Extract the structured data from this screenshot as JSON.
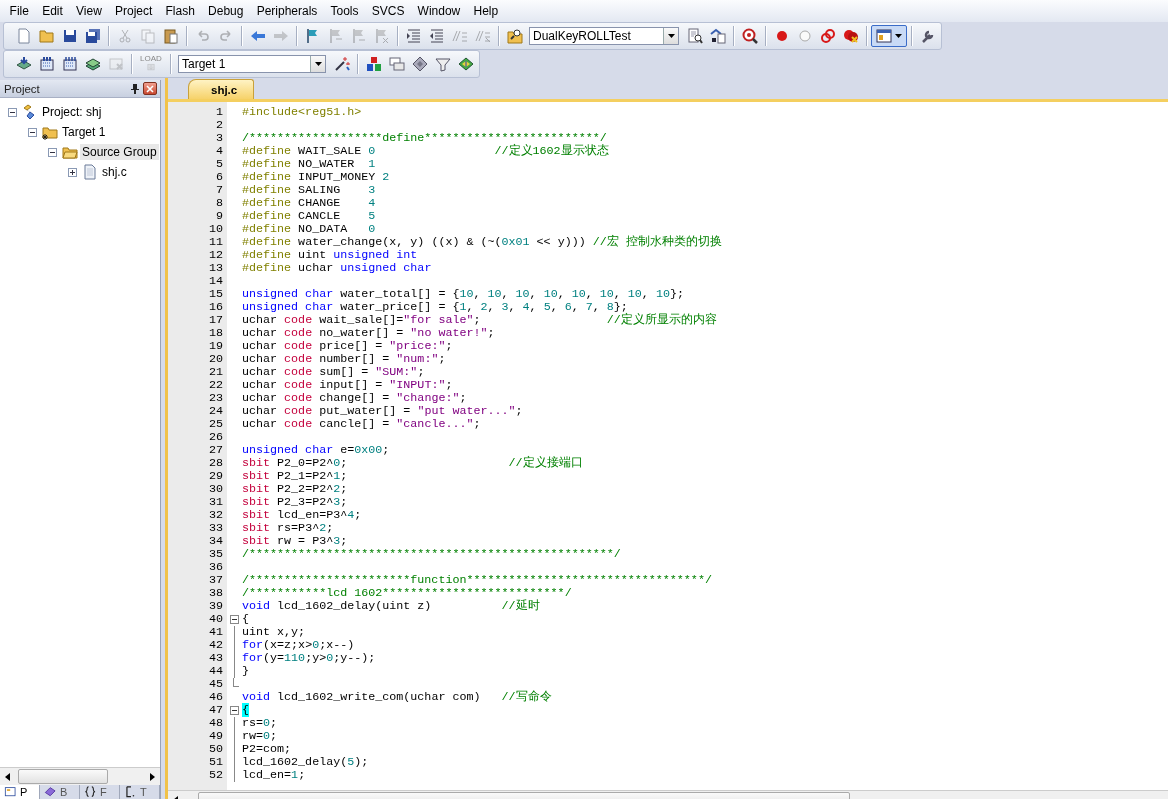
{
  "menu": [
    "File",
    "Edit",
    "View",
    "Project",
    "Flash",
    "Debug",
    "Peripherals",
    "Tools",
    "SVCS",
    "Window",
    "Help"
  ],
  "toolbar_1": [
    [
      {
        "kind": "new-file",
        "disabled": false,
        "on": false
      },
      {
        "kind": "open-file",
        "disabled": false,
        "on": false
      },
      {
        "kind": "save",
        "disabled": false,
        "on": false
      },
      {
        "kind": "save-all",
        "disabled": false,
        "on": false
      }
    ],
    [
      {
        "kind": "cut",
        "disabled": true,
        "on": false
      },
      {
        "kind": "copy",
        "disabled": true,
        "on": false
      },
      {
        "kind": "paste",
        "disabled": false,
        "on": false
      }
    ],
    [
      {
        "kind": "undo",
        "disabled": true,
        "on": false
      },
      {
        "kind": "redo",
        "disabled": true,
        "on": false
      }
    ],
    [
      {
        "kind": "nav-back",
        "disabled": false,
        "on": false
      },
      {
        "kind": "nav-forward",
        "disabled": true,
        "on": false
      }
    ],
    [
      {
        "kind": "bookmark",
        "disabled": false,
        "on": false
      },
      {
        "kind": "bookmark-prev",
        "disabled": true,
        "on": false
      },
      {
        "kind": "bookmark-next",
        "disabled": true,
        "on": false
      },
      {
        "kind": "bookmark-clear",
        "disabled": true,
        "on": false
      }
    ],
    [
      {
        "kind": "indent",
        "disabled": false,
        "on": false
      },
      {
        "kind": "unindent",
        "disabled": false,
        "on": false
      },
      {
        "kind": "comment",
        "disabled": true,
        "on": false
      },
      {
        "kind": "uncomment",
        "disabled": true,
        "on": false
      }
    ],
    [
      {
        "kind": "find-in-files",
        "disabled": false,
        "on": false
      },
      {
        "kind": "combo",
        "value": "DualKeyROLLTest"
      },
      {
        "kind": "find",
        "disabled": false,
        "on": false
      },
      {
        "kind": "incremental-find",
        "disabled": false,
        "on": false
      }
    ],
    [
      {
        "kind": "debug",
        "disabled": false,
        "on": false
      }
    ],
    [
      {
        "kind": "breakpoint",
        "disabled": false,
        "on": false
      },
      {
        "kind": "breakpoint-off",
        "disabled": false,
        "on": false
      },
      {
        "kind": "breakpoint-disable-all",
        "disabled": false,
        "on": false
      },
      {
        "kind": "breakpoint-kill-all",
        "disabled": false,
        "on": false
      }
    ],
    [
      {
        "kind": "window-layout",
        "disabled": false,
        "on": true
      }
    ],
    [
      {
        "kind": "configure",
        "disabled": false,
        "on": false
      }
    ]
  ],
  "toolbar_2": [
    [
      {
        "kind": "translate",
        "disabled": false,
        "on": false
      },
      {
        "kind": "build",
        "disabled": false,
        "on": false
      },
      {
        "kind": "rebuild",
        "disabled": false,
        "on": false
      },
      {
        "kind": "batch-build",
        "disabled": false,
        "on": false
      },
      {
        "kind": "stop-build",
        "disabled": true,
        "on": false
      }
    ],
    [
      {
        "kind": "download",
        "label": "LOAD",
        "disabled": true,
        "on": false
      }
    ],
    [
      {
        "kind": "combo",
        "value": "Target 1"
      },
      {
        "kind": "target-options",
        "disabled": false,
        "on": false
      }
    ],
    [
      {
        "kind": "manage-components",
        "disabled": false,
        "on": false
      },
      {
        "kind": "select-packs",
        "disabled": false,
        "on": false
      },
      {
        "kind": "pack-installer",
        "disabled": false,
        "on": false
      },
      {
        "kind": "run-time-environment",
        "disabled": false,
        "on": false
      },
      {
        "kind": "pack-manager",
        "disabled": false,
        "on": false
      }
    ]
  ],
  "project_panel": {
    "title": "Project",
    "tree": [
      {
        "label": "Project: shj",
        "kind": "project",
        "expanded": true,
        "selected": false,
        "children": [
          {
            "label": "Target 1",
            "kind": "target",
            "expanded": true,
            "selected": false,
            "children": [
              {
                "label": "Source Group",
                "kind": "group",
                "expanded": true,
                "selected": true,
                "children": [
                  {
                    "label": "shj.c",
                    "kind": "file",
                    "expanded": false,
                    "selected": false
                  }
                ]
              }
            ]
          }
        ]
      }
    ],
    "tabs": [
      {
        "label": "P",
        "kind": "project",
        "selected": true
      },
      {
        "label": "B",
        "kind": "books",
        "selected": false
      },
      {
        "label": "F",
        "kind": "functions",
        "selected": false
      },
      {
        "label": "T",
        "kind": "templates",
        "selected": false
      }
    ]
  },
  "editor": {
    "tabs": [
      {
        "label": "shj.c",
        "selected": true
      }
    ],
    "lines": [
      {
        "number": "1",
        "segments": [
          {
            "text": "#include<reg51.h>",
            "kind": "directive"
          }
        ]
      },
      {
        "number": "2"
      },
      {
        "number": "3",
        "segments": [
          {
            "text": "/*******************define*************************/",
            "kind": "comment"
          }
        ]
      },
      {
        "number": "4",
        "segments": [
          {
            "text": "#define",
            "kind": "directive"
          },
          {
            "text": " WAIT_SALE ",
            "kind": "plain"
          },
          {
            "text": "0",
            "kind": "number"
          },
          {
            "text": "                 //定义1602显示状态",
            "kind": "comment"
          }
        ]
      },
      {
        "number": "5",
        "segments": [
          {
            "text": "#define",
            "kind": "directive"
          },
          {
            "text": " NO_WATER  ",
            "kind": "plain"
          },
          {
            "text": "1",
            "kind": "number"
          }
        ]
      },
      {
        "number": "6",
        "segments": [
          {
            "text": "#define",
            "kind": "directive"
          },
          {
            "text": " INPUT_MONEY ",
            "kind": "plain"
          },
          {
            "text": "2",
            "kind": "number"
          }
        ]
      },
      {
        "number": "7",
        "segments": [
          {
            "text": "#define",
            "kind": "directive"
          },
          {
            "text": " SALING    ",
            "kind": "plain"
          },
          {
            "text": "3",
            "kind": "number"
          }
        ]
      },
      {
        "number": "8",
        "segments": [
          {
            "text": "#define",
            "kind": "directive"
          },
          {
            "text": " CHANGE    ",
            "kind": "plain"
          },
          {
            "text": "4",
            "kind": "number"
          }
        ]
      },
      {
        "number": "9",
        "segments": [
          {
            "text": "#define",
            "kind": "directive"
          },
          {
            "text": " CANCLE    ",
            "kind": "plain"
          },
          {
            "text": "5",
            "kind": "number"
          }
        ]
      },
      {
        "number": "10",
        "segments": [
          {
            "text": "#define",
            "kind": "directive"
          },
          {
            "text": " NO_DATA   ",
            "kind": "plain"
          },
          {
            "text": "0",
            "kind": "number"
          }
        ]
      },
      {
        "number": "11",
        "segments": [
          {
            "text": "#define",
            "kind": "directive"
          },
          {
            "text": " water_change(x, y) ((x) & (~(",
            "kind": "plain"
          },
          {
            "text": "0x01",
            "kind": "number"
          },
          {
            "text": " << y))) ",
            "kind": "plain"
          },
          {
            "text": "//宏 控制水种类的切换",
            "kind": "comment"
          }
        ]
      },
      {
        "number": "12",
        "segments": [
          {
            "text": "#define",
            "kind": "directive"
          },
          {
            "text": " uint ",
            "kind": "plain"
          },
          {
            "text": "unsigned int",
            "kind": "keyword"
          }
        ]
      },
      {
        "number": "13",
        "segments": [
          {
            "text": "#define",
            "kind": "directive"
          },
          {
            "text": " uchar ",
            "kind": "plain"
          },
          {
            "text": "unsigned char",
            "kind": "keyword"
          }
        ]
      },
      {
        "number": "14"
      },
      {
        "number": "15",
        "segments": [
          {
            "text": "unsigned char",
            "kind": "keyword"
          },
          {
            "text": " water_total[] = {",
            "kind": "plain"
          },
          {
            "text": "10",
            "kind": "number"
          },
          {
            "text": ", ",
            "kind": "plain"
          },
          {
            "text": "10",
            "kind": "number"
          },
          {
            "text": ", ",
            "kind": "plain"
          },
          {
            "text": "10",
            "kind": "number"
          },
          {
            "text": ", ",
            "kind": "plain"
          },
          {
            "text": "10",
            "kind": "number"
          },
          {
            "text": ", ",
            "kind": "plain"
          },
          {
            "text": "10",
            "kind": "number"
          },
          {
            "text": ", ",
            "kind": "plain"
          },
          {
            "text": "10",
            "kind": "number"
          },
          {
            "text": ", ",
            "kind": "plain"
          },
          {
            "text": "10",
            "kind": "number"
          },
          {
            "text": ", ",
            "kind": "plain"
          },
          {
            "text": "10",
            "kind": "number"
          },
          {
            "text": "};",
            "kind": "plain"
          }
        ]
      },
      {
        "number": "16",
        "segments": [
          {
            "text": "unsigned char",
            "kind": "keyword"
          },
          {
            "text": " water_price[] = {",
            "kind": "plain"
          },
          {
            "text": "1",
            "kind": "number"
          },
          {
            "text": ", ",
            "kind": "plain"
          },
          {
            "text": "2",
            "kind": "number"
          },
          {
            "text": ", ",
            "kind": "plain"
          },
          {
            "text": "3",
            "kind": "number"
          },
          {
            "text": ", ",
            "kind": "plain"
          },
          {
            "text": "4",
            "kind": "number"
          },
          {
            "text": ", ",
            "kind": "plain"
          },
          {
            "text": "5",
            "kind": "number"
          },
          {
            "text": ", ",
            "kind": "plain"
          },
          {
            "text": "6",
            "kind": "number"
          },
          {
            "text": ", ",
            "kind": "plain"
          },
          {
            "text": "7",
            "kind": "number"
          },
          {
            "text": ", ",
            "kind": "plain"
          },
          {
            "text": "8",
            "kind": "number"
          },
          {
            "text": "};",
            "kind": "plain"
          }
        ]
      },
      {
        "number": "17",
        "segments": [
          {
            "text": "uchar ",
            "kind": "plain"
          },
          {
            "text": "code",
            "kind": "storage"
          },
          {
            "text": " wait_sale[]=",
            "kind": "plain"
          },
          {
            "text": "\"for sale\"",
            "kind": "string"
          },
          {
            "text": ";                  ",
            "kind": "plain"
          },
          {
            "text": "//定义所显示的内容",
            "kind": "comment"
          }
        ]
      },
      {
        "number": "18",
        "segments": [
          {
            "text": "uchar ",
            "kind": "plain"
          },
          {
            "text": "code",
            "kind": "storage"
          },
          {
            "text": " no_water[] = ",
            "kind": "plain"
          },
          {
            "text": "\"no water!\"",
            "kind": "string"
          },
          {
            "text": ";",
            "kind": "plain"
          }
        ]
      },
      {
        "number": "19",
        "segments": [
          {
            "text": "uchar ",
            "kind": "plain"
          },
          {
            "text": "code",
            "kind": "storage"
          },
          {
            "text": " price[] = ",
            "kind": "plain"
          },
          {
            "text": "\"price:\"",
            "kind": "string"
          },
          {
            "text": ";",
            "kind": "plain"
          }
        ]
      },
      {
        "number": "20",
        "segments": [
          {
            "text": "uchar ",
            "kind": "plain"
          },
          {
            "text": "code",
            "kind": "storage"
          },
          {
            "text": " number[] = ",
            "kind": "plain"
          },
          {
            "text": "\"num:\"",
            "kind": "string"
          },
          {
            "text": ";",
            "kind": "plain"
          }
        ]
      },
      {
        "number": "21",
        "segments": [
          {
            "text": "uchar ",
            "kind": "plain"
          },
          {
            "text": "code",
            "kind": "storage"
          },
          {
            "text": " sum[] = ",
            "kind": "plain"
          },
          {
            "text": "\"SUM:\"",
            "kind": "string"
          },
          {
            "text": ";",
            "kind": "plain"
          }
        ]
      },
      {
        "number": "22",
        "segments": [
          {
            "text": "uchar ",
            "kind": "plain"
          },
          {
            "text": "code",
            "kind": "storage"
          },
          {
            "text": " input[] = ",
            "kind": "plain"
          },
          {
            "text": "\"INPUT:\"",
            "kind": "string"
          },
          {
            "text": ";",
            "kind": "plain"
          }
        ]
      },
      {
        "number": "23",
        "segments": [
          {
            "text": "uchar ",
            "kind": "plain"
          },
          {
            "text": "code",
            "kind": "storage"
          },
          {
            "text": " change[] = ",
            "kind": "plain"
          },
          {
            "text": "\"change:\"",
            "kind": "string"
          },
          {
            "text": ";",
            "kind": "plain"
          }
        ]
      },
      {
        "number": "24",
        "segments": [
          {
            "text": "uchar ",
            "kind": "plain"
          },
          {
            "text": "code",
            "kind": "storage"
          },
          {
            "text": " put_water[] = ",
            "kind": "plain"
          },
          {
            "text": "\"put water...\"",
            "kind": "string"
          },
          {
            "text": ";",
            "kind": "plain"
          }
        ]
      },
      {
        "number": "25",
        "segments": [
          {
            "text": "uchar ",
            "kind": "plain"
          },
          {
            "text": "code",
            "kind": "storage"
          },
          {
            "text": " cancle[] = ",
            "kind": "plain"
          },
          {
            "text": "\"cancle...\"",
            "kind": "string"
          },
          {
            "text": ";",
            "kind": "plain"
          }
        ]
      },
      {
        "number": "26"
      },
      {
        "number": "27",
        "segments": [
          {
            "text": "unsigned char",
            "kind": "keyword"
          },
          {
            "text": " e=",
            "kind": "plain"
          },
          {
            "text": "0x00",
            "kind": "number"
          },
          {
            "text": ";",
            "kind": "plain"
          }
        ]
      },
      {
        "number": "28",
        "segments": [
          {
            "text": "sbit",
            "kind": "storage"
          },
          {
            "text": " P2_0=P2^",
            "kind": "plain"
          },
          {
            "text": "0",
            "kind": "number"
          },
          {
            "text": ";                       ",
            "kind": "plain"
          },
          {
            "text": "//定义接端口",
            "kind": "comment"
          }
        ]
      },
      {
        "number": "29",
        "segments": [
          {
            "text": "sbit",
            "kind": "storage"
          },
          {
            "text": " P2_1=P2^",
            "kind": "plain"
          },
          {
            "text": "1",
            "kind": "number"
          },
          {
            "text": ";",
            "kind": "plain"
          }
        ]
      },
      {
        "number": "30",
        "segments": [
          {
            "text": "sbit",
            "kind": "storage"
          },
          {
            "text": " P2_2=P2^",
            "kind": "plain"
          },
          {
            "text": "2",
            "kind": "number"
          },
          {
            "text": ";",
            "kind": "plain"
          }
        ]
      },
      {
        "number": "31",
        "segments": [
          {
            "text": "sbit",
            "kind": "storage"
          },
          {
            "text": " P2_3=P2^",
            "kind": "plain"
          },
          {
            "text": "3",
            "kind": "number"
          },
          {
            "text": ";",
            "kind": "plain"
          }
        ]
      },
      {
        "number": "32",
        "segments": [
          {
            "text": "sbit",
            "kind": "storage"
          },
          {
            "text": " lcd_en=P3^",
            "kind": "plain"
          },
          {
            "text": "4",
            "kind": "number"
          },
          {
            "text": ";",
            "kind": "plain"
          }
        ]
      },
      {
        "number": "33",
        "segments": [
          {
            "text": "sbit",
            "kind": "storage"
          },
          {
            "text": " rs=P3^",
            "kind": "plain"
          },
          {
            "text": "2",
            "kind": "number"
          },
          {
            "text": ";",
            "kind": "plain"
          }
        ]
      },
      {
        "number": "34",
        "segments": [
          {
            "text": "sbit",
            "kind": "storage"
          },
          {
            "text": " rw = P3^",
            "kind": "plain"
          },
          {
            "text": "3",
            "kind": "number"
          },
          {
            "text": ";",
            "kind": "plain"
          }
        ]
      },
      {
        "number": "35",
        "segments": [
          {
            "text": "/****************************************************/",
            "kind": "comment"
          }
        ]
      },
      {
        "number": "36"
      },
      {
        "number": "37",
        "segments": [
          {
            "text": "/***********************function**********************************/",
            "kind": "comment"
          }
        ]
      },
      {
        "number": "38",
        "segments": [
          {
            "text": "/***********lcd 1602**************************/",
            "kind": "comment"
          }
        ]
      },
      {
        "number": "39",
        "segments": [
          {
            "text": "void",
            "kind": "keyword"
          },
          {
            "text": " lcd_1602_delay(uint z)          ",
            "kind": "plain"
          },
          {
            "text": "//延时",
            "kind": "comment"
          }
        ]
      },
      {
        "number": "40",
        "kind": "fold-start",
        "segments": [
          {
            "text": "{",
            "kind": "plain"
          }
        ]
      },
      {
        "number": "41",
        "kind": "fold-body",
        "segments": [
          {
            "text": "uint x,y;",
            "kind": "plain"
          }
        ]
      },
      {
        "number": "42",
        "kind": "fold-body",
        "segments": [
          {
            "text": "for",
            "kind": "keyword"
          },
          {
            "text": "(x=z;x>",
            "kind": "plain"
          },
          {
            "text": "0",
            "kind": "number"
          },
          {
            "text": ";x--)",
            "kind": "plain"
          }
        ]
      },
      {
        "number": "43",
        "kind": "fold-body",
        "segments": [
          {
            "text": "for",
            "kind": "keyword"
          },
          {
            "text": "(y=",
            "kind": "plain"
          },
          {
            "text": "110",
            "kind": "number"
          },
          {
            "text": ";y>",
            "kind": "plain"
          },
          {
            "text": "0",
            "kind": "number"
          },
          {
            "text": ";y--);",
            "kind": "plain"
          }
        ]
      },
      {
        "number": "44",
        "kind": "fold-body",
        "segments": [
          {
            "text": "}",
            "kind": "plain"
          }
        ]
      },
      {
        "number": "45",
        "kind": "fold-end"
      },
      {
        "number": "46",
        "segments": [
          {
            "text": "void",
            "kind": "keyword"
          },
          {
            "text": " lcd_1602_write_com(uchar com)   ",
            "kind": "plain"
          },
          {
            "text": "//写命令",
            "kind": "comment"
          }
        ]
      },
      {
        "number": "47",
        "kind": "fold-start",
        "segments": [
          {
            "text": "{",
            "kind": "match"
          }
        ]
      },
      {
        "number": "48",
        "kind": "fold-body",
        "segments": [
          {
            "text": "rs=",
            "kind": "plain"
          },
          {
            "text": "0",
            "kind": "number"
          },
          {
            "text": ";",
            "kind": "plain"
          }
        ]
      },
      {
        "number": "49",
        "kind": "fold-body",
        "segments": [
          {
            "text": "rw=",
            "kind": "plain"
          },
          {
            "text": "0",
            "kind": "number"
          },
          {
            "text": ";",
            "kind": "plain"
          }
        ]
      },
      {
        "number": "50",
        "kind": "fold-body",
        "segments": [
          {
            "text": "P2=com;",
            "kind": "plain"
          }
        ]
      },
      {
        "number": "51",
        "kind": "fold-body",
        "segments": [
          {
            "text": "lcd_1602_delay(",
            "kind": "plain"
          },
          {
            "text": "5",
            "kind": "number"
          },
          {
            "text": ");",
            "kind": "plain"
          }
        ]
      },
      {
        "number": "52",
        "kind": "fold-body",
        "segments": [
          {
            "text": "lcd_en=",
            "kind": "plain"
          },
          {
            "text": "1",
            "kind": "number"
          },
          {
            "text": ";",
            "kind": "plain"
          }
        ]
      }
    ]
  }
}
